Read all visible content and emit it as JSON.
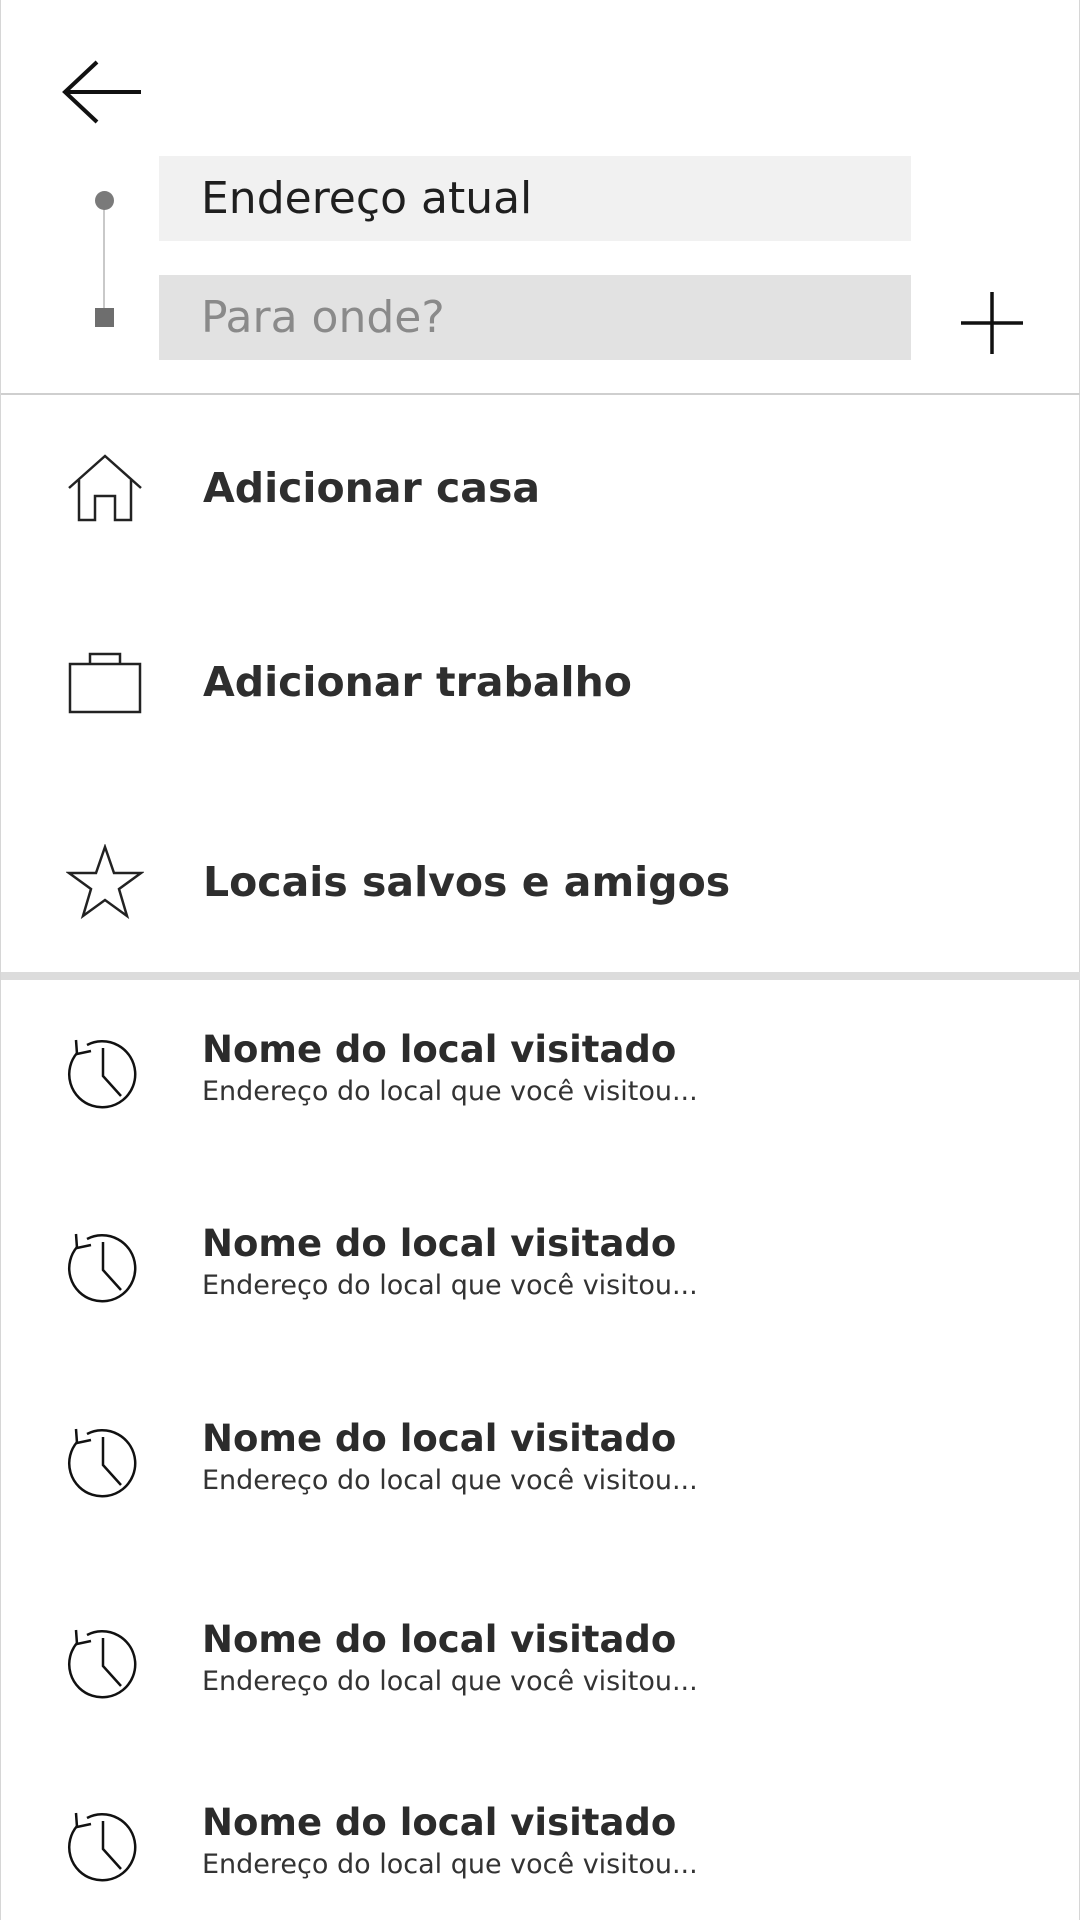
{
  "header": {
    "origin_value": "Endereço atual",
    "destination_placeholder": "Para onde?"
  },
  "shortcuts": [
    {
      "label": "Adicionar casa",
      "icon": "home-icon"
    },
    {
      "label": "Adicionar trabalho",
      "icon": "briefcase-icon"
    },
    {
      "label": "Locais salvos e amigos",
      "icon": "star-icon"
    }
  ],
  "history": [
    {
      "title": "Nome do local visitado",
      "subtitle": "Endereço do local que você visitou..."
    },
    {
      "title": "Nome do local visitado",
      "subtitle": "Endereço do local que você visitou..."
    },
    {
      "title": "Nome do local visitado",
      "subtitle": "Endereço do local que você visitou..."
    },
    {
      "title": "Nome do local visitado",
      "subtitle": "Endereço do local que você visitou..."
    },
    {
      "title": "Nome do local visitado",
      "subtitle": "Endereço do local que você visitou..."
    }
  ],
  "icons": {
    "back": "arrow-left-icon",
    "add": "plus-icon",
    "history": "history-clock-icon"
  },
  "colors": {
    "origin_field": "#f1f1f1",
    "destination_field": "#e2e2e2",
    "text": "#2b2b2b"
  }
}
